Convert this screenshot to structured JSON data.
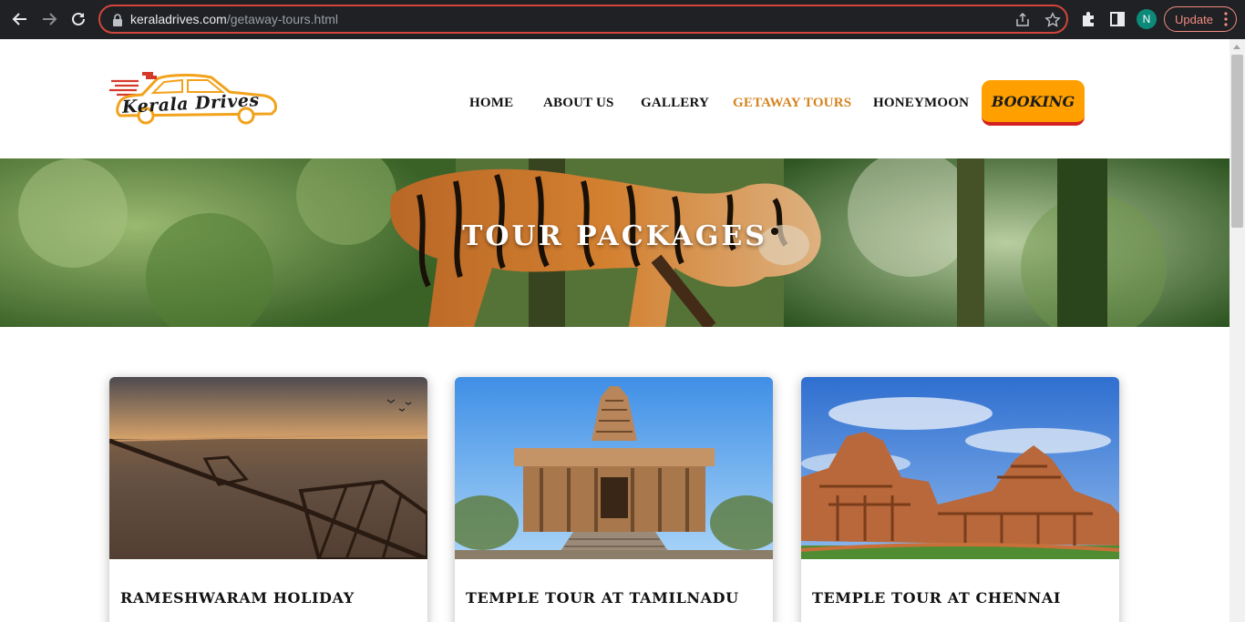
{
  "browser": {
    "url_domain": "keraladrives.com",
    "url_path": "/getaway-tours.html",
    "profile_initial": "N",
    "update_label": "Update"
  },
  "site": {
    "logo_text": "Kerala Drives",
    "nav": [
      {
        "label": "HOME",
        "active": false
      },
      {
        "label": "ABOUT US",
        "active": false
      },
      {
        "label": "GALLERY",
        "active": false
      },
      {
        "label": "GETAWAY TOURS",
        "active": true
      },
      {
        "label": "HONEYMOON",
        "active": false
      }
    ],
    "booking_label": "BOOKING",
    "accent_color": "#ffa000",
    "active_nav_color": "#d4831f"
  },
  "banner": {
    "title": "TOUR PACKAGES"
  },
  "cards": [
    {
      "title": "RAMESHWARAM HOLIDAY"
    },
    {
      "title": "TEMPLE TOUR AT TAMILNADU"
    },
    {
      "title": "TEMPLE TOUR AT CHENNAI"
    }
  ]
}
